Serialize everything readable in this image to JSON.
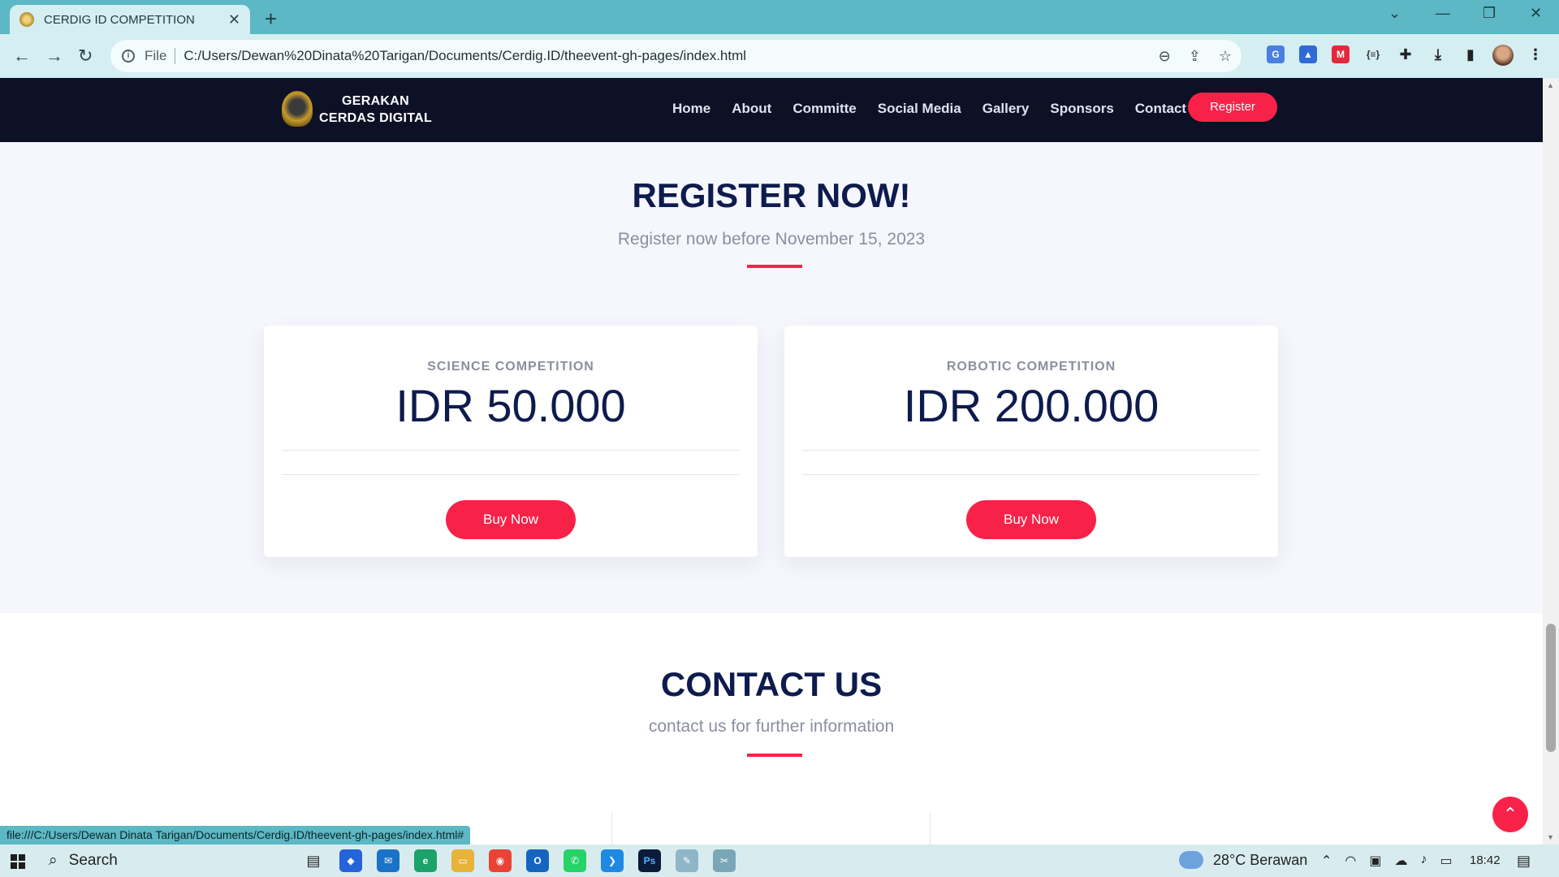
{
  "browser": {
    "tab_title": "CERDIG ID COMPETITION",
    "tab_close": "✕",
    "new_tab": "+",
    "url_scheme": "File",
    "url": "C:/Users/Dewan%20Dinata%20Tarigan/Documents/Cerdig.ID/theevent-gh-pages/index.html",
    "status_url": "file:///C:/Users/Dewan Dinata Tarigan/Documents/Cerdig.ID/theevent-gh-pages/index.html#"
  },
  "site": {
    "logo_line1": "GERAKAN",
    "logo_line2": "CERDAS DIGITAL",
    "nav": [
      "Home",
      "About",
      "Committe",
      "Social Media",
      "Gallery",
      "Sponsors",
      "Contact"
    ],
    "register_button": "Register"
  },
  "register": {
    "title": "REGISTER NOW!",
    "subtitle": "Register now before November 15, 2023",
    "cards": [
      {
        "category": "SCIENCE COMPETITION",
        "price": "IDR 50.000",
        "button": "Buy Now"
      },
      {
        "category": "ROBOTIC COMPETITION",
        "price": "IDR 200.000",
        "button": "Buy Now"
      }
    ]
  },
  "contact": {
    "title": "CONTACT US",
    "subtitle": "contact us for further information"
  },
  "taskbar": {
    "search_label": "Search",
    "weather": "28°C  Berawan",
    "time": "18:42"
  },
  "colors": {
    "accent": "#f82249",
    "navy": "#0e1b4d",
    "header_bg": "#0d1126",
    "chrome": "#5bb8c4"
  }
}
